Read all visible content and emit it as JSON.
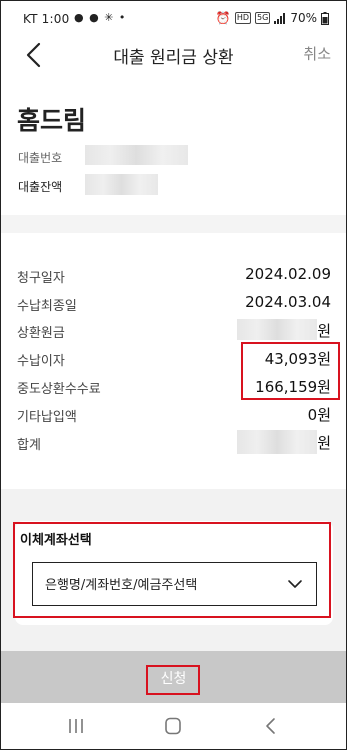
{
  "status_bar": {
    "carrier_time": "KT 1:00",
    "notif_dots": "● ● ✳ •",
    "battery": "70%"
  },
  "header": {
    "title": "대출 원리금 상환",
    "cancel_label": "취소"
  },
  "loan": {
    "company": "홈드림",
    "number_label": "대출번호",
    "balance_label": "대출잔액"
  },
  "details": [
    {
      "label": "청구일자",
      "value": "2024.02.09"
    },
    {
      "label": "수납최종일",
      "value": "2024.03.04"
    },
    {
      "label": "상환원금",
      "value": "원"
    },
    {
      "label": "수납이자",
      "value": "43,093원"
    },
    {
      "label": "중도상환수수료",
      "value": "166,159원"
    },
    {
      "label": "기타납입액",
      "value": "0원"
    },
    {
      "label": "합계",
      "value": "원"
    }
  ],
  "account_select": {
    "title": "이체계좌선택",
    "selected": "은행명/계좌번호/예금주선택"
  },
  "apply_label": "신청",
  "colors": {
    "highlight": "#d8121f",
    "apply_disabled": "#c8c8c8"
  },
  "icons": {
    "back": "chevron-left-icon",
    "dropdown": "chevron-down-icon",
    "nav_recents": "recents-icon",
    "nav_home": "home-icon",
    "nav_back": "back-icon"
  }
}
